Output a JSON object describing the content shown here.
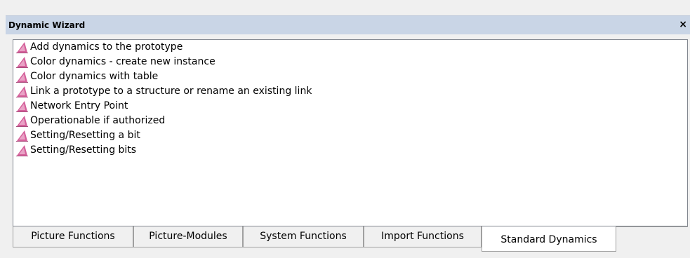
{
  "window": {
    "title": "Dynamic Wizard",
    "close_glyph": "×"
  },
  "list": {
    "icon": "pink-triangle-icon",
    "icon_color": "#d4609a",
    "items": [
      "Add dynamics to the prototype",
      "Color dynamics - create new instance",
      "Color dynamics with table",
      "Link a prototype to a structure or rename an existing link",
      "Network Entry Point",
      "Operationable if authorized",
      "Setting/Resetting a bit",
      "Setting/Resetting bits"
    ]
  },
  "tabs": [
    {
      "label": "Picture Functions",
      "active": false
    },
    {
      "label": "Picture-Modules",
      "active": false
    },
    {
      "label": "System Functions",
      "active": false
    },
    {
      "label": "Import Functions",
      "active": false
    },
    {
      "label": "Standard Dynamics",
      "active": true
    }
  ],
  "colors": {
    "titlebar": "#c9d5e6",
    "list_background": "#ffffff",
    "tab_background": "#f0f0f0"
  }
}
